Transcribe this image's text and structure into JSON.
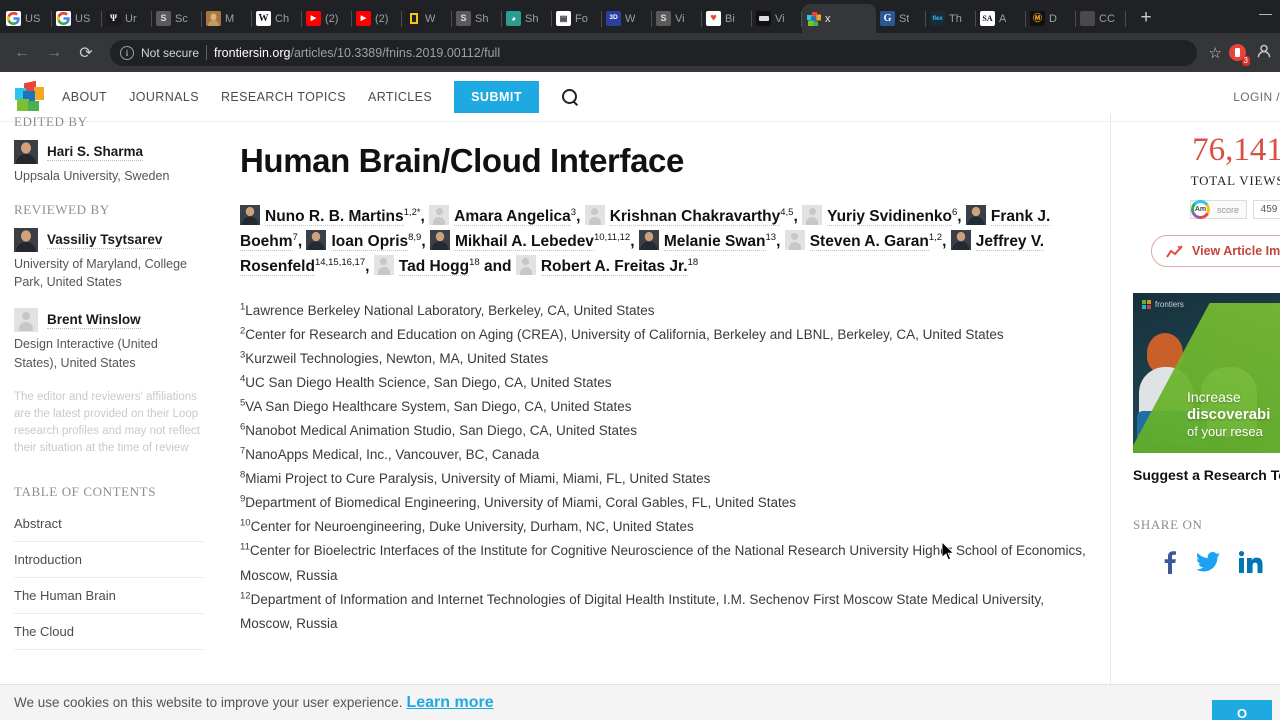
{
  "browser": {
    "tabs": [
      {
        "label": "US",
        "favicon": "google-icon",
        "type": "google"
      },
      {
        "label": "US",
        "favicon": "google-icon",
        "type": "google"
      },
      {
        "label": "Ur",
        "favicon": "university-icon",
        "type": "dark"
      },
      {
        "label": "Sc",
        "favicon": "sciencedirect-icon",
        "type": "grey"
      },
      {
        "label": "M",
        "favicon": "portrait-icon",
        "type": "portrait"
      },
      {
        "label": "Ch",
        "favicon": "wikipedia-icon",
        "type": "wiki"
      },
      {
        "label": "(2)",
        "favicon": "youtube-icon",
        "type": "youtube"
      },
      {
        "label": "(2)",
        "favicon": "youtube-icon",
        "type": "youtube"
      },
      {
        "label": "W",
        "favicon": "yellowbook-icon",
        "type": "yellow"
      },
      {
        "label": "Sh",
        "favicon": "sciencedirect-icon",
        "type": "grey"
      },
      {
        "label": "Sh",
        "favicon": "globe-icon",
        "type": "teal"
      },
      {
        "label": "Fo",
        "favicon": "document-icon",
        "type": "doc"
      },
      {
        "label": "W",
        "favicon": "3dprint-icon",
        "type": "blue3d"
      },
      {
        "label": "Vi",
        "favicon": "sciencedirect-icon",
        "type": "grey"
      },
      {
        "label": "Bi",
        "favicon": "heart-icon",
        "type": "heart"
      },
      {
        "label": "Vi",
        "favicon": "widget-icon",
        "type": "black"
      },
      {
        "label": "x",
        "favicon": "frontiers-icon",
        "type": "frontiers",
        "active": true
      },
      {
        "label": "St",
        "favicon": "google-scholar-icon",
        "type": "gblue"
      },
      {
        "label": "Th",
        "favicon": "flex-icon",
        "type": "flex"
      },
      {
        "label": "A",
        "favicon": "scientific-american-icon",
        "type": "sa"
      },
      {
        "label": "D",
        "favicon": "mf-icon",
        "type": "orange"
      },
      {
        "label": "CC",
        "favicon": "grey-icon",
        "type": "plain"
      }
    ],
    "new_tab_label": "+",
    "minimize_label": "—",
    "nav": {
      "back": "←",
      "forward": "→",
      "reload": "⟳"
    },
    "omnibox": {
      "info_glyph": "i",
      "security_text": "Not secure",
      "url_host": "frontiersin.org",
      "url_path": "/articles/10.3389/fnins.2019.00112/full"
    },
    "bookmark_star": "☆",
    "extension_badge_count": "3"
  },
  "site": {
    "nav_items": [
      {
        "label": "ABOUT"
      },
      {
        "label": "JOURNALS"
      },
      {
        "label": "RESEARCH TOPICS"
      },
      {
        "label": "ARTICLES"
      }
    ],
    "submit_label": "SUBMIT",
    "login_label": "LOGIN /"
  },
  "sidebar": {
    "edited_by_heading": "EDITED BY",
    "editors": [
      {
        "name": "Hari S. Sharma",
        "affiliation": "Uppsala University, Sweden",
        "avatar": "photo"
      }
    ],
    "reviewed_by_heading": "REVIEWED BY",
    "reviewers": [
      {
        "name": "Vassiliy Tsytsarev",
        "affiliation": "University of Maryland, College Park, United States",
        "avatar": "photo"
      },
      {
        "name": "Brent Winslow",
        "affiliation": "Design Interactive (United States), United States",
        "avatar": "placeholder"
      }
    ],
    "disclaimer": "The editor and reviewers' affiliations are the latest provided on their Loop research profiles and may not reflect their situation at the time of review",
    "toc_heading": "TABLE OF CONTENTS",
    "toc_items": [
      {
        "label": "Abstract"
      },
      {
        "label": "Introduction"
      },
      {
        "label": "The Human Brain"
      },
      {
        "label": "The Cloud"
      }
    ]
  },
  "article": {
    "title": "Human Brain/Cloud Interface",
    "authors": [
      {
        "name": "Nuno R. B. Martins",
        "sup": "1,2*",
        "avatar": "photo",
        "sep": ", "
      },
      {
        "name": "Amara Angelica",
        "sup": "3",
        "avatar": "placeholder",
        "sep": ", "
      },
      {
        "name": "Krishnan Chakravarthy",
        "sup": "4,5",
        "avatar": "placeholder",
        "sep": ", "
      },
      {
        "name": "Yuriy Svidinenko",
        "sup": "6",
        "avatar": "placeholder",
        "sep": ", "
      },
      {
        "name": "Frank J. Boehm",
        "sup": "7",
        "avatar": "photo",
        "sep": ", "
      },
      {
        "name": "Ioan Opris",
        "sup": "8,9",
        "avatar": "photo",
        "sep": ", "
      },
      {
        "name": "Mikhail A. Lebedev",
        "sup": "10,11,12",
        "avatar": "photo",
        "sep": ", "
      },
      {
        "name": "Melanie Swan",
        "sup": "13",
        "avatar": "photo",
        "sep": ", "
      },
      {
        "name": "Steven A. Garan",
        "sup": "1,2",
        "avatar": "placeholder",
        "sep": ", "
      },
      {
        "name": "Jeffrey V. Rosenfeld",
        "sup": "14,15,16,17",
        "avatar": "photo",
        "sep": ", "
      },
      {
        "name": "Tad Hogg",
        "sup": "18",
        "avatar": "placeholder",
        "sep": " and "
      },
      {
        "name": "Robert A. Freitas Jr.",
        "sup": "18",
        "avatar": "placeholder",
        "sep": ""
      }
    ],
    "affiliations": [
      {
        "num": "1",
        "text": "Lawrence Berkeley National Laboratory, Berkeley, CA, United States"
      },
      {
        "num": "2",
        "text": "Center for Research and Education on Aging (CREA), University of California, Berkeley and LBNL, Berkeley, CA, United States"
      },
      {
        "num": "3",
        "text": "Kurzweil Technologies, Newton, MA, United States"
      },
      {
        "num": "4",
        "text": "UC San Diego Health Science, San Diego, CA, United States"
      },
      {
        "num": "5",
        "text": "VA San Diego Healthcare System, San Diego, CA, United States"
      },
      {
        "num": "6",
        "text": "Nanobot Medical Animation Studio, San Diego, CA, United States"
      },
      {
        "num": "7",
        "text": "NanoApps Medical, Inc., Vancouver, BC, Canada"
      },
      {
        "num": "8",
        "text": "Miami Project to Cure Paralysis, University of Miami, Miami, FL, United States"
      },
      {
        "num": "9",
        "text": "Department of Biomedical Engineering, University of Miami, Coral Gables, FL, United States"
      },
      {
        "num": "10",
        "text": "Center for Neuroengineering, Duke University, Durham, NC, United States"
      },
      {
        "num": "11",
        "text": "Center for Bioelectric Interfaces of the Institute for Cognitive Neuroscience of the National Research University Higher School of Economics, Moscow, Russia"
      },
      {
        "num": "12",
        "text": "Department of Information and Internet Technologies of Digital Health Institute, I.M. Sechenov First Moscow State Medical University, Moscow, Russia"
      }
    ]
  },
  "metrics": {
    "total_views_value": "76,141",
    "total_views_label": "TOTAL VIEWS",
    "altmetric_badge_label": "Am",
    "altmetric_score_label": "score",
    "altmetric_count": "459",
    "impact_button_label": "View Article Imp",
    "promo": {
      "brand": "frontiers",
      "line1": "Increase",
      "line2": "discoverabi",
      "line3": "of your resea"
    },
    "suggest_label": "Suggest a Research To",
    "share_heading": "SHARE ON",
    "share_icons": [
      {
        "name": "facebook-icon",
        "color": "#3b5998"
      },
      {
        "name": "twitter-icon",
        "color": "#1da1f2"
      },
      {
        "name": "linkedin-icon",
        "color": "#0077b5"
      },
      {
        "name": "share-icon",
        "color": "#1da1f2"
      }
    ]
  },
  "cookie": {
    "text": "We use cookies on this website to improve your user experience.",
    "link_label": "Learn more",
    "ok_label": "O"
  },
  "colors": {
    "brand_blue": "#1eaae1",
    "views_red": "#d94f45",
    "chrome_dark": "#202124"
  }
}
